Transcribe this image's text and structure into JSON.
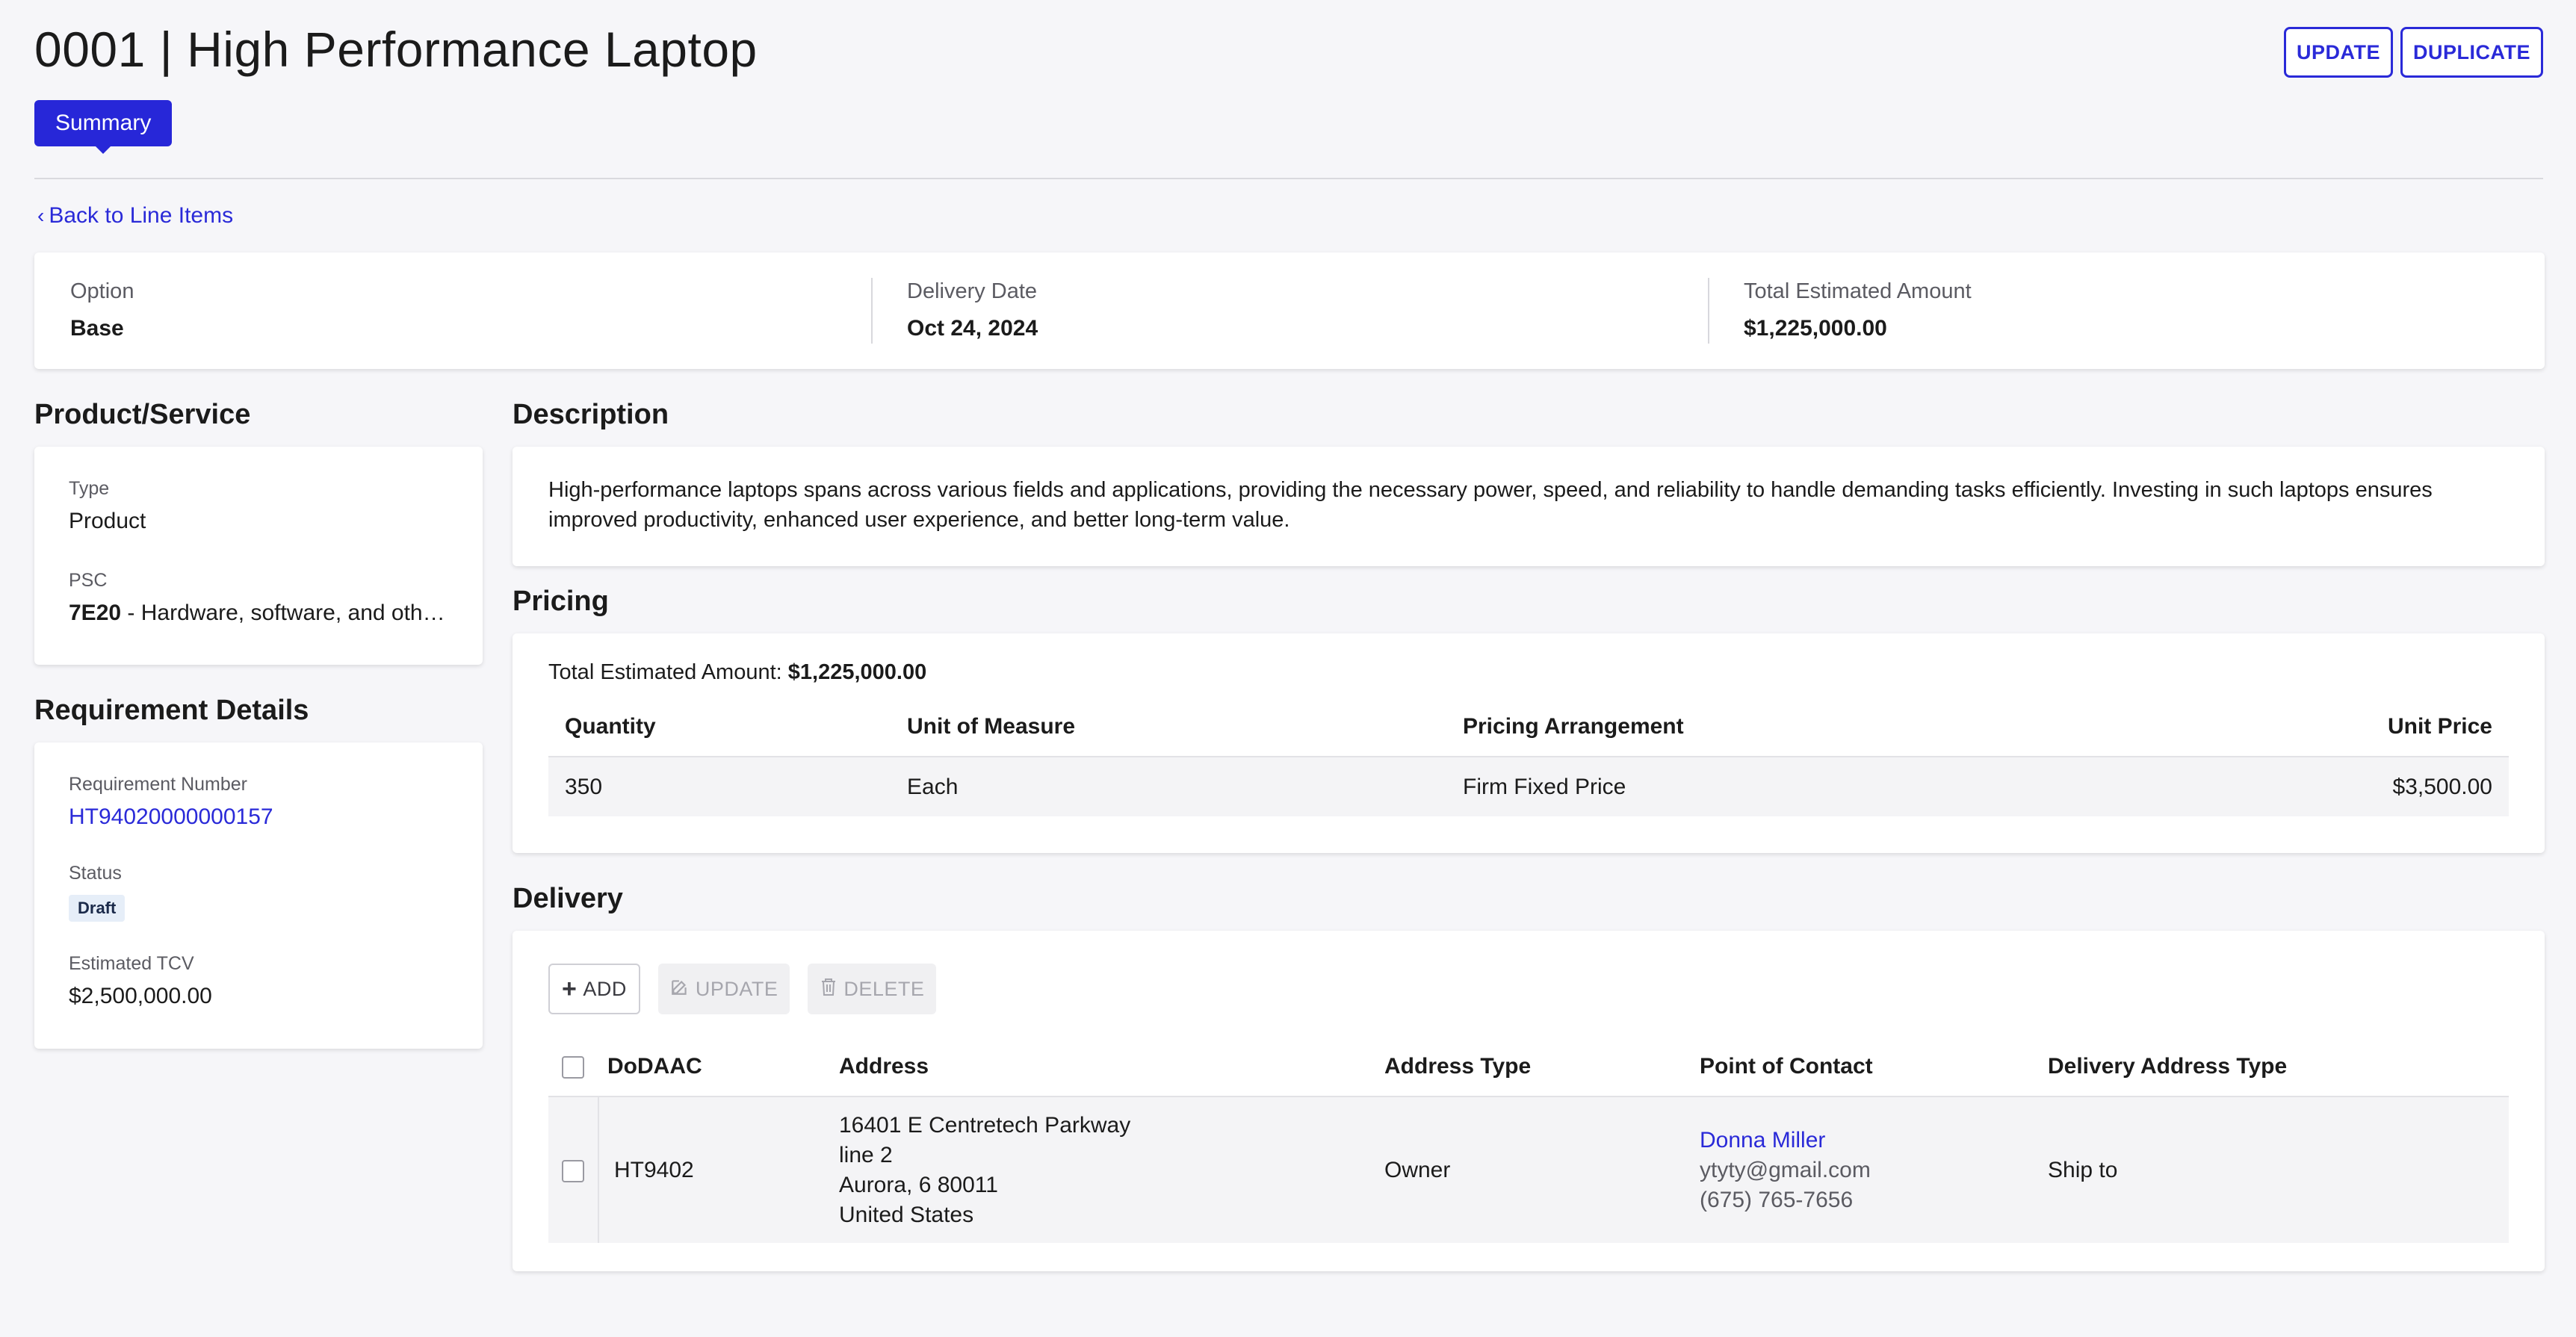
{
  "header": {
    "title": "0001 | High Performance Laptop",
    "update_label": "UPDATE",
    "duplicate_label": "DUPLICATE"
  },
  "tabs": {
    "summary_label": "Summary"
  },
  "back_link": "Back to Line Items",
  "summary": {
    "option_label": "Option",
    "option_value": "Base",
    "delivery_date_label": "Delivery Date",
    "delivery_date_value": "Oct 24, 2024",
    "total_label": "Total Estimated Amount",
    "total_value": "$1,225,000.00"
  },
  "product_service": {
    "title": "Product/Service",
    "type_label": "Type",
    "type_value": "Product",
    "psc_label": "PSC",
    "psc_code": "7E20",
    "psc_desc": " - Hardware, software, and other IT products"
  },
  "requirement_details": {
    "title": "Requirement Details",
    "req_number_label": "Requirement Number",
    "req_number_value": "HT94020000000157",
    "status_label": "Status",
    "status_value": "Draft",
    "tcv_label": "Estimated TCV",
    "tcv_value": "$2,500,000.00"
  },
  "description": {
    "title": "Description",
    "text": "High-performance laptops spans across various fields and applications, providing the necessary power, speed, and reliability to handle demanding tasks efficiently. Investing in such laptops ensures improved productivity, enhanced user experience, and better long-term value."
  },
  "pricing": {
    "title": "Pricing",
    "total_prefix": "Total Estimated Amount: ",
    "total_value": "$1,225,000.00",
    "columns": [
      "Quantity",
      "Unit of Measure",
      "Pricing Arrangement",
      "Unit Price"
    ],
    "rows": [
      {
        "quantity": "350",
        "unit": "Each",
        "arrangement": "Firm Fixed Price",
        "unit_price": "$3,500.00"
      }
    ]
  },
  "delivery": {
    "title": "Delivery",
    "add_label": "ADD",
    "update_label": "UPDATE",
    "delete_label": "DELETE",
    "columns": [
      "DoDAAC",
      "Address",
      "Address Type",
      "Point of Contact",
      "Delivery Address Type"
    ],
    "rows": [
      {
        "dodaac": "HT9402",
        "address_line1": "16401 E Centretech Parkway",
        "address_line2": "line 2",
        "address_line3": "Aurora, 6 80011",
        "address_line4": "United States",
        "address_type": "Owner",
        "contact_name": "Donna Miller",
        "contact_email": "ytyty@gmail.com",
        "contact_phone": "(675) 765-7656",
        "delivery_address_type": "Ship to"
      }
    ]
  },
  "colors": {
    "accent": "#2a2ad8",
    "background": "#f6f6f9",
    "status_badge_bg": "#e6eef8"
  }
}
